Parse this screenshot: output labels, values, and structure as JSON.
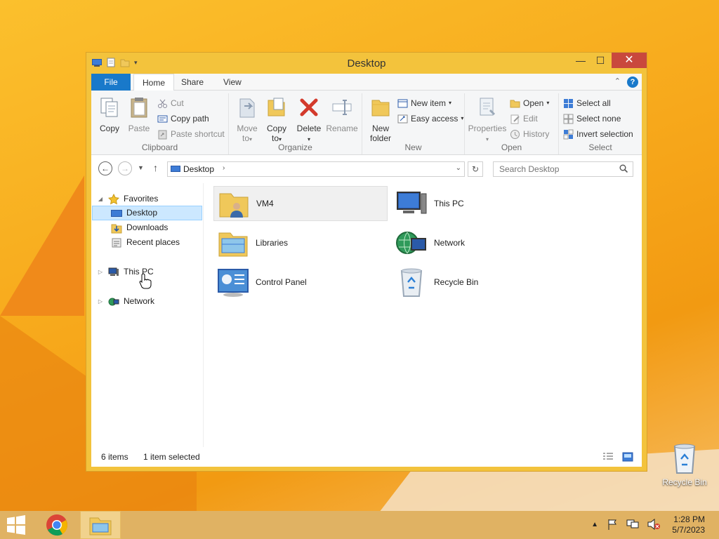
{
  "window": {
    "title": "Desktop"
  },
  "tabs": {
    "file": "File",
    "home": "Home",
    "share": "Share",
    "view": "View"
  },
  "ribbon": {
    "clipboard": {
      "label": "Clipboard",
      "copy": "Copy",
      "paste": "Paste",
      "cut": "Cut",
      "copy_path": "Copy path",
      "paste_shortcut": "Paste shortcut"
    },
    "organize": {
      "label": "Organize",
      "move_to": "Move",
      "move_to_2": "to",
      "copy_to": "Copy",
      "copy_to_2": "to",
      "delete": "Delete",
      "rename": "Rename"
    },
    "new": {
      "label": "New",
      "new_folder": "New",
      "new_folder_2": "folder",
      "new_item": "New item",
      "easy_access": "Easy access"
    },
    "open": {
      "label": "Open",
      "properties": "Properties",
      "open": "Open",
      "edit": "Edit",
      "history": "History"
    },
    "select": {
      "label": "Select",
      "select_all": "Select all",
      "select_none": "Select none",
      "invert": "Invert selection"
    }
  },
  "address": {
    "path": "Desktop",
    "search_placeholder": "Search Desktop"
  },
  "nav": {
    "favorites": "Favorites",
    "desktop": "Desktop",
    "downloads": "Downloads",
    "recent": "Recent places",
    "this_pc": "This PC",
    "network": "Network"
  },
  "content": {
    "items": [
      {
        "label": "VM4",
        "selected": true
      },
      {
        "label": "This PC"
      },
      {
        "label": "Libraries"
      },
      {
        "label": "Network"
      },
      {
        "label": "Control Panel"
      },
      {
        "label": "Recycle Bin"
      }
    ]
  },
  "status": {
    "count": "6 items",
    "selected": "1 item selected"
  },
  "desktop": {
    "recycle_bin": "Recycle Bin"
  },
  "taskbar": {
    "time": "1:28 PM",
    "date": "5/7/2023"
  },
  "colors": {
    "accent": "#1979ca",
    "close": "#c9483d",
    "selection": "#cce8ff"
  }
}
